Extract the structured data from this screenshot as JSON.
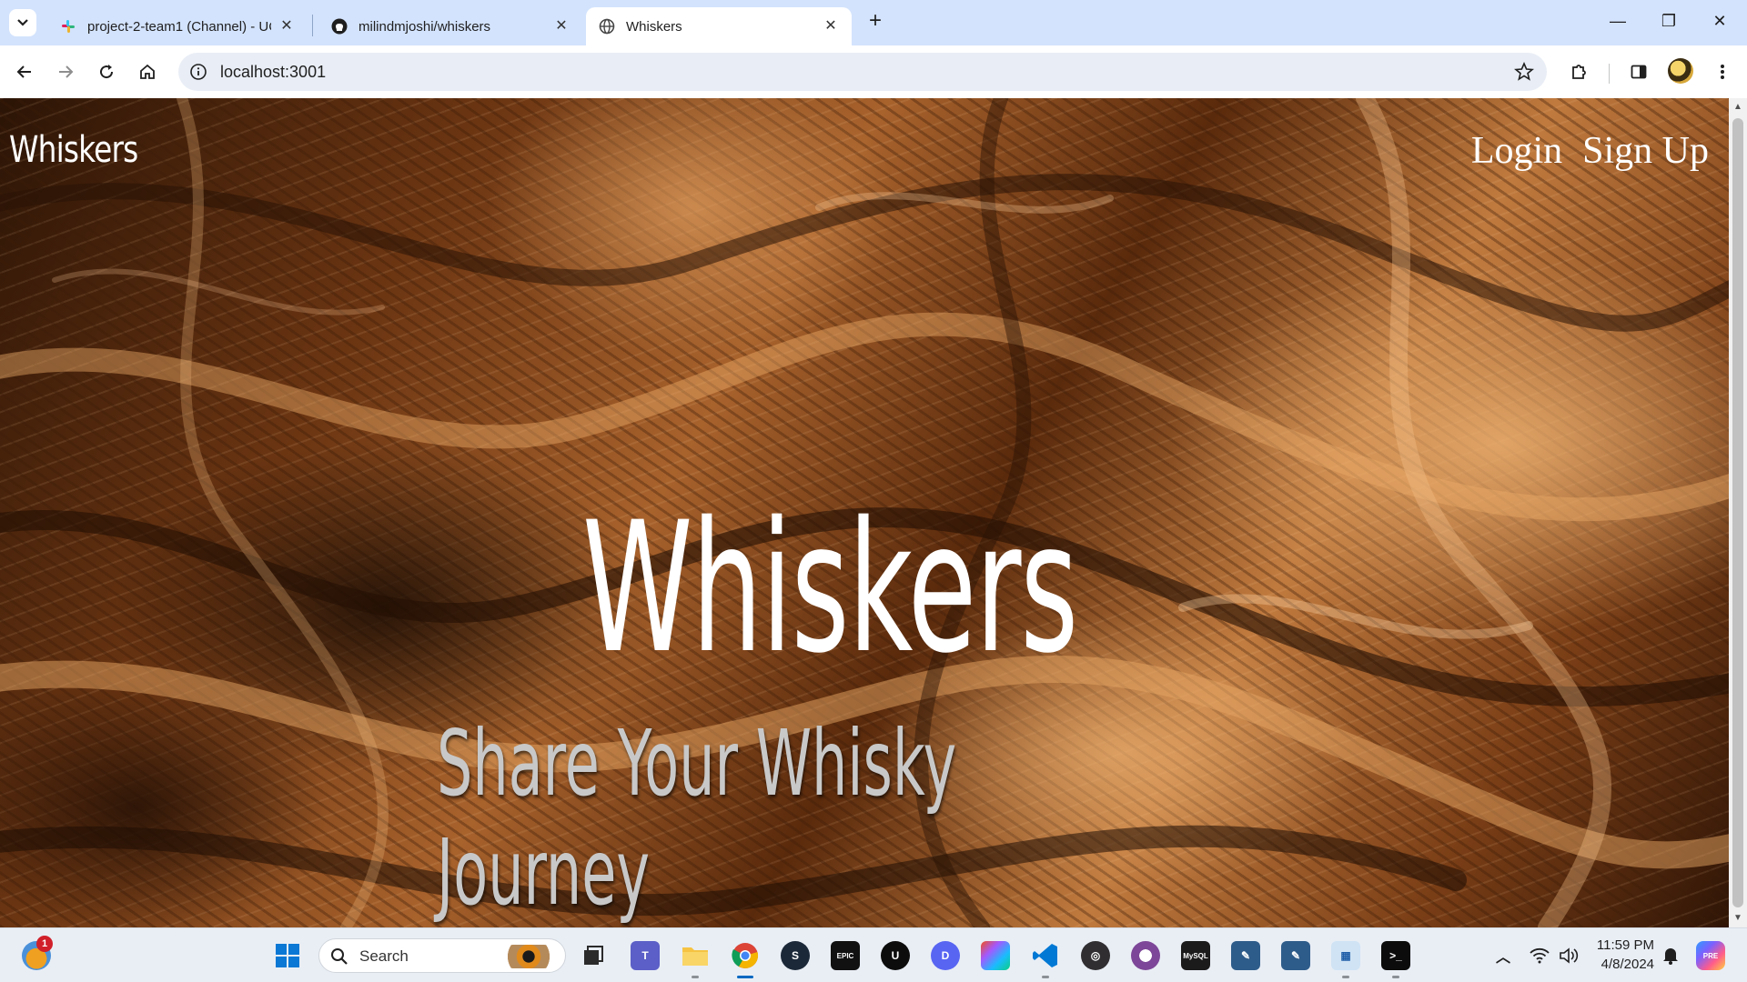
{
  "browser": {
    "tabs": [
      {
        "title": "project-2-team1 (Channel) - UC",
        "icon": "slack-icon",
        "active": false
      },
      {
        "title": "milindmjoshi/whiskers",
        "icon": "github-icon",
        "active": false
      },
      {
        "title": "Whiskers",
        "icon": "globe-icon",
        "active": true
      }
    ],
    "url": "localhost:3001"
  },
  "page": {
    "site_logo": "Whiskers",
    "nav": {
      "login": "Login",
      "signup": "Sign Up"
    },
    "hero_title": "Whiskers",
    "hero_subtitle": "Share Your Whisky\nJourney"
  },
  "taskbar": {
    "search_placeholder": "Search",
    "notification_count": "1",
    "apps": [
      "widgets",
      "start",
      "search",
      "task-view",
      "teams",
      "file-explorer",
      "chrome",
      "steam",
      "epic-games",
      "ubisoft-connect",
      "discord",
      "figma",
      "vscode",
      "obs",
      "tor",
      "mysql-workbench",
      "mysql-workbench-2",
      "mysql-workbench-3",
      "paint",
      "terminal"
    ],
    "time": "11:59 PM",
    "date": "4/8/2024"
  },
  "colors": {
    "tabbar_bg": "#d3e3fd",
    "omnibox_bg": "#e9eef6",
    "taskbar_bg": "#e9eef5",
    "hero_text": "#ffffff",
    "subtitle_text": "#c8c8c8"
  }
}
